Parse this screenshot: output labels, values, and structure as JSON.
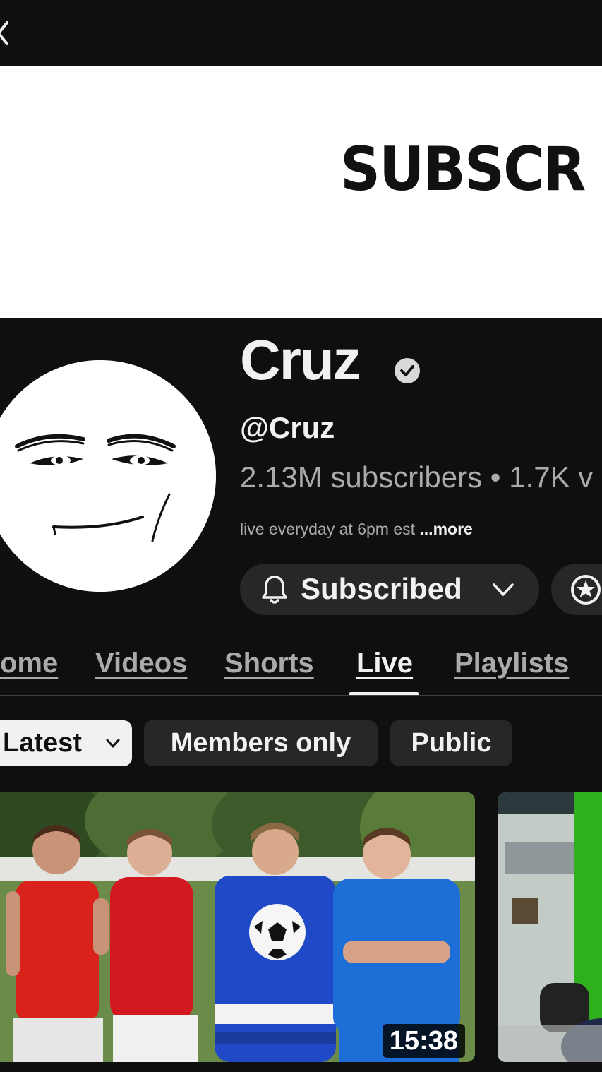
{
  "banner": {
    "text": "SUBSCR"
  },
  "channel": {
    "name": "Cruz",
    "handle": "@Cruz",
    "stats": "2.13M subscribers • 1.7K v",
    "description": "live everyday at 6pm est ",
    "more_label": "...more"
  },
  "subscribe": {
    "label": "Subscribed"
  },
  "tabs": [
    {
      "label": "ome",
      "active": false
    },
    {
      "label": "Videos",
      "active": false
    },
    {
      "label": "Shorts",
      "active": false
    },
    {
      "label": "Live",
      "active": true
    },
    {
      "label": "Playlists",
      "active": false
    }
  ],
  "chips": [
    {
      "label": "Latest",
      "selected": true
    },
    {
      "label": "Members only",
      "selected": false
    },
    {
      "label": "Public",
      "selected": false
    }
  ],
  "videos": [
    {
      "duration": "15:38"
    }
  ],
  "icons": {
    "back": "chevron-left-icon",
    "verified": "verified-check-icon",
    "bell": "bell-icon",
    "chevron": "chevron-down-icon",
    "join": "star-badge-icon"
  },
  "colors": {
    "background": "#0f0f0f",
    "surface": "#272727",
    "text_primary": "#f1f1f1",
    "text_secondary": "#aaaaaa"
  }
}
